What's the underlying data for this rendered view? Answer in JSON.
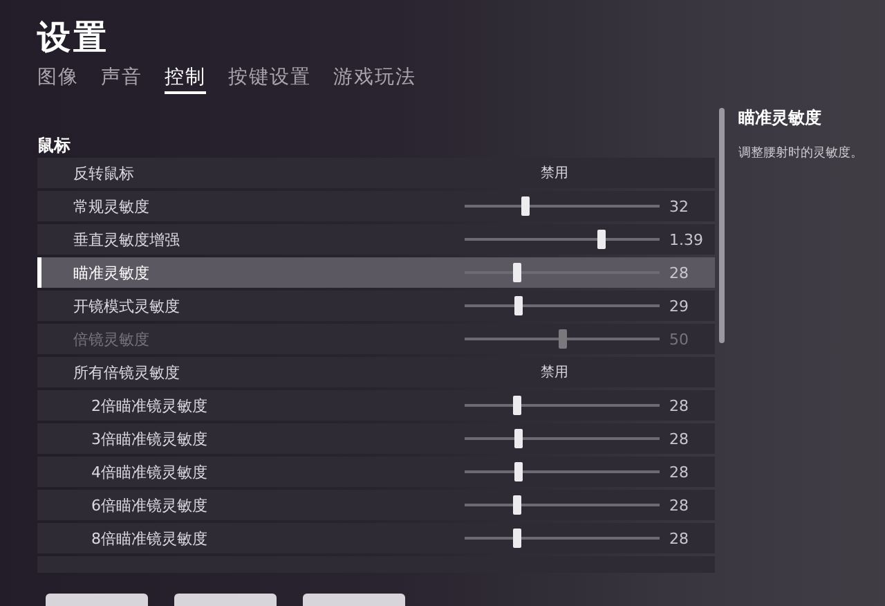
{
  "title": "设置",
  "tabs": [
    {
      "label": "图像",
      "selected": false
    },
    {
      "label": "声音",
      "selected": false
    },
    {
      "label": "控制",
      "selected": true
    },
    {
      "label": "按键设置",
      "selected": false
    },
    {
      "label": "游戏玩法",
      "selected": false
    }
  ],
  "section": "鼠标",
  "rows": [
    {
      "label": "反转鼠标",
      "kind": "toggle",
      "value": "禁用",
      "selected": false,
      "disabled": false
    },
    {
      "label": "常规灵敏度",
      "kind": "slider",
      "level": 0.31,
      "reading": "32",
      "selected": false,
      "disabled": false
    },
    {
      "label": "垂直灵敏度增强",
      "kind": "slider",
      "level": 0.7,
      "reading": "1.39",
      "selected": false,
      "disabled": false
    },
    {
      "label": "瞄准灵敏度",
      "kind": "slider",
      "level": 0.27,
      "reading": "28",
      "selected": true,
      "disabled": false
    },
    {
      "label": "开镜模式灵敏度",
      "kind": "slider",
      "level": 0.28,
      "reading": "29",
      "selected": false,
      "disabled": false
    },
    {
      "label": "倍镜灵敏度",
      "kind": "slider",
      "level": 0.5,
      "reading": "50",
      "selected": false,
      "disabled": true
    },
    {
      "label": "所有倍镜灵敏度",
      "kind": "toggle",
      "value": "禁用",
      "selected": false,
      "disabled": false,
      "children": [
        {
          "label": "2倍瞄准镜灵敏度",
          "kind": "slider",
          "level": 0.27,
          "reading": "28",
          "selected": false,
          "disabled": false
        },
        {
          "label": "3倍瞄准镜灵敏度",
          "kind": "slider",
          "level": 0.28,
          "reading": "28",
          "selected": false,
          "disabled": false
        },
        {
          "label": "4倍瞄准镜灵敏度",
          "kind": "slider",
          "level": 0.28,
          "reading": "28",
          "selected": false,
          "disabled": false
        },
        {
          "label": "6倍瞄准镜灵敏度",
          "kind": "slider",
          "level": 0.27,
          "reading": "28",
          "selected": false,
          "disabled": false
        },
        {
          "label": "8倍瞄准镜灵敏度",
          "kind": "slider",
          "level": 0.27,
          "reading": "28",
          "selected": false,
          "disabled": false
        }
      ]
    }
  ],
  "detail": {
    "title": "瞄准灵敏度",
    "description": "调整腰射时的灵敏度。"
  }
}
